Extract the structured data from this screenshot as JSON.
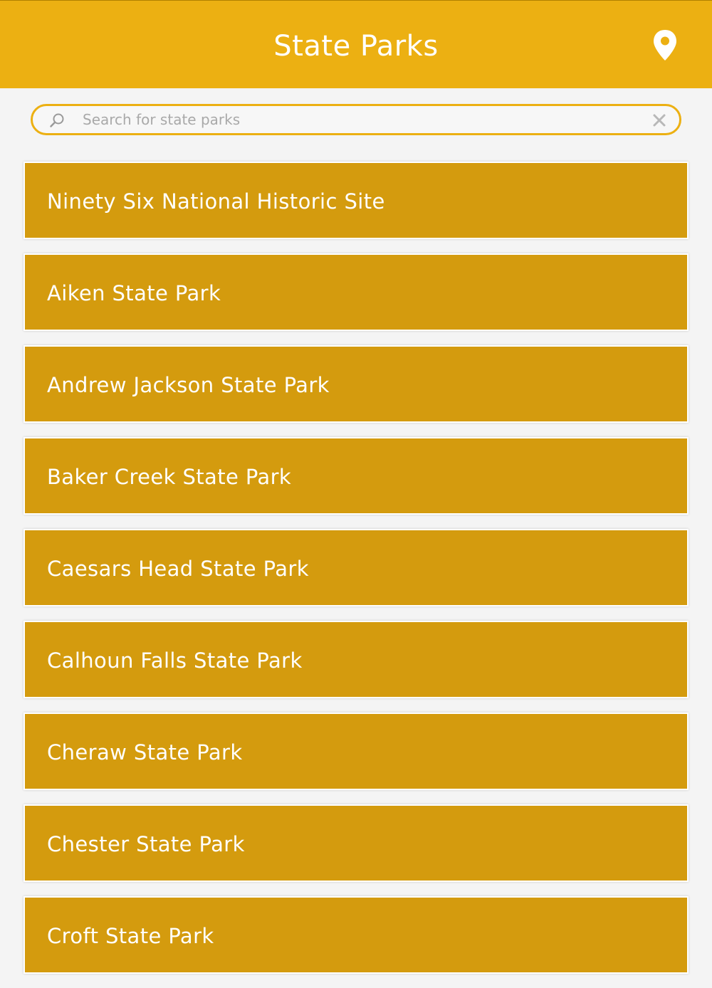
{
  "header": {
    "title": "State Parks",
    "map_icon": "map-pin-icon"
  },
  "search": {
    "placeholder": "Search for state parks",
    "value": "",
    "search_icon": "search-icon",
    "clear_icon": "close-icon"
  },
  "parks": [
    {
      "name": "Ninety Six National Historic Site"
    },
    {
      "name": "Aiken State Park"
    },
    {
      "name": "Andrew Jackson State Park"
    },
    {
      "name": "Baker Creek State Park"
    },
    {
      "name": "Caesars Head State Park"
    },
    {
      "name": "Calhoun Falls State Park"
    },
    {
      "name": "Cheraw State Park"
    },
    {
      "name": "Chester State Park"
    },
    {
      "name": "Croft State Park"
    }
  ],
  "colors": {
    "header_background": "#ecb012",
    "list_item_background": "#d49b0e",
    "page_background": "#f4f4f4",
    "text_on_accent": "#ffffff"
  }
}
